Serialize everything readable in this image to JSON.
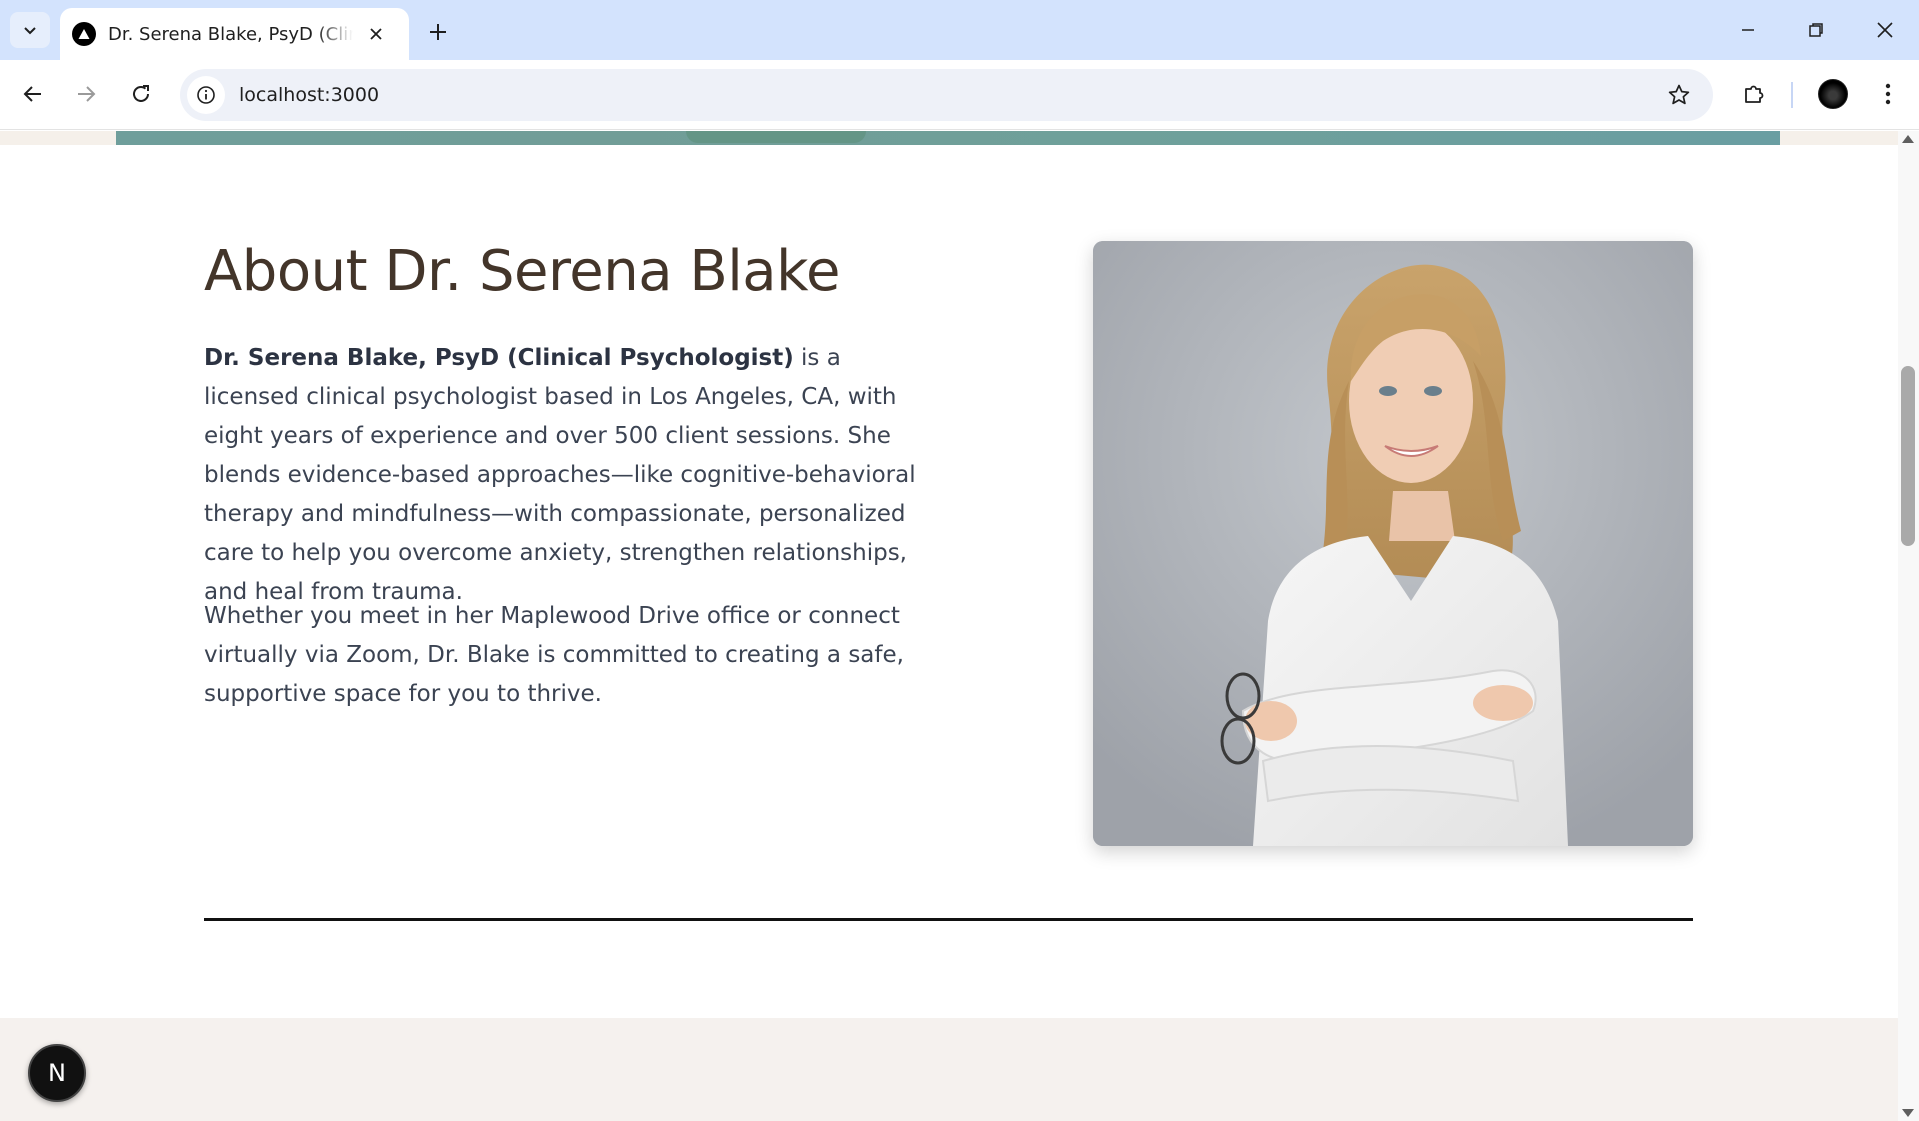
{
  "browser": {
    "tab_title": "Dr. Serena Blake, PsyD (Clinical Psychologist)",
    "url": "localhost:3000"
  },
  "about": {
    "title": "About Dr. Serena Blake",
    "bold_intro": "Dr. Serena Blake, PsyD (Clinical Psychologist)",
    "paragraph1_rest": " is a licensed clinical psychologist based in Los Angeles, CA, with eight years of experience and over 500 client sessions. She blends evidence-based approaches—like cognitive-behavioral therapy and mindfulness—with compassionate, personalized care to help you overcome anxiety, strengthen relationships, and heal from trauma.",
    "paragraph2": "Whether you meet in her Maplewood Drive office or connect virtually via Zoom, Dr. Blake is committed to creating a safe, supportive space for you to thrive."
  },
  "dev_badge": {
    "label": "N"
  },
  "icons": {
    "tab_menu": "chevron-down-icon",
    "favicon": "triangle-logo-icon",
    "close": "close-icon",
    "new_tab": "plus-icon",
    "minimize": "minimize-icon",
    "restore": "restore-icon",
    "window_close": "close-icon",
    "back": "back-arrow-icon",
    "forward": "forward-arrow-icon",
    "reload": "reload-icon",
    "site_info": "info-icon",
    "bookmark": "star-icon",
    "extensions": "puzzle-icon",
    "menu": "kebab-menu-icon"
  },
  "colors": {
    "tab_strip": "#d3e3fd",
    "title_text": "#43352a",
    "body_text": "#3b4352",
    "hero_teal": "#6f9e9b",
    "footer_band": "#f5f1ee"
  }
}
